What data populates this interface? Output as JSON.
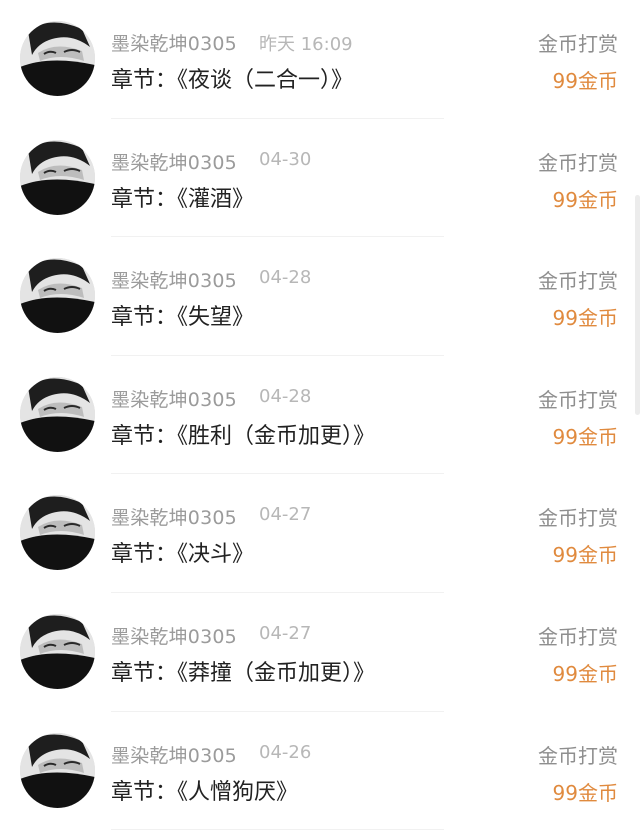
{
  "chapter_prefix": "章节：",
  "records": [
    {
      "user": "墨染乾坤0305",
      "time": "昨天 16:09",
      "chapter": "《夜谈（二合一）》",
      "kind": "金币打赏",
      "amount": "99金币"
    },
    {
      "user": "墨染乾坤0305",
      "time": "04-30",
      "chapter": "《灌酒》",
      "kind": "金币打赏",
      "amount": "99金币"
    },
    {
      "user": "墨染乾坤0305",
      "time": "04-28",
      "chapter": "《失望》",
      "kind": "金币打赏",
      "amount": "99金币"
    },
    {
      "user": "墨染乾坤0305",
      "time": "04-28",
      "chapter": "《胜利（金币加更）》",
      "kind": "金币打赏",
      "amount": "99金币"
    },
    {
      "user": "墨染乾坤0305",
      "time": "04-27",
      "chapter": "《决斗》",
      "kind": "金币打赏",
      "amount": "99金币"
    },
    {
      "user": "墨染乾坤0305",
      "time": "04-27",
      "chapter": "《莽撞（金币加更）》",
      "kind": "金币打赏",
      "amount": "99金币"
    },
    {
      "user": "墨染乾坤0305",
      "time": "04-26",
      "chapter": "《人憎狗厌》",
      "kind": "金币打赏",
      "amount": "99金币"
    }
  ],
  "colors": {
    "username": "#9b9b9b",
    "time": "#b7b7b7",
    "chapter": "#222222",
    "kind": "#8e8e8e",
    "amount": "#e08a3e"
  },
  "icons": {
    "avatar": "user-avatar-photo"
  }
}
